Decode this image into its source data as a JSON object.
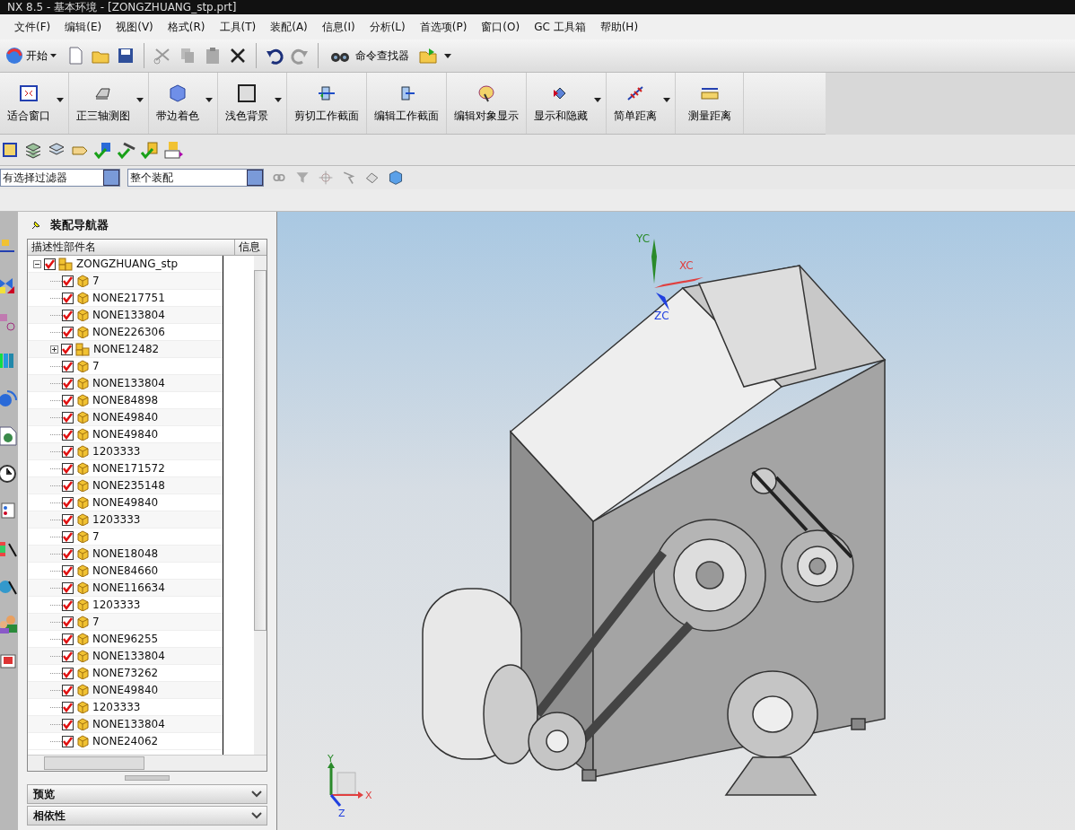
{
  "window": {
    "title": "NX 8.5 - 基本环境 - [ZONGZHUANG_stp.prt]"
  },
  "menu": [
    "文件(F)",
    "编辑(E)",
    "视图(V)",
    "格式(R)",
    "工具(T)",
    "装配(A)",
    "信息(I)",
    "分析(L)",
    "首选项(P)",
    "窗口(O)",
    "GC 工具箱",
    "帮助(H)"
  ],
  "standard_toolbar": {
    "start": "开始",
    "finder": "命令查找器"
  },
  "view_toolbar": [
    {
      "label": "适合窗口",
      "dropdown": true
    },
    {
      "label": "正三轴测图",
      "dropdown": true
    },
    {
      "label": "带边着色",
      "dropdown": true
    },
    {
      "label": "浅色背景",
      "dropdown": true
    },
    {
      "label": "剪切工作截面",
      "dropdown": false
    },
    {
      "label": "编辑工作截面",
      "dropdown": false
    },
    {
      "label": "编辑对象显示",
      "dropdown": false
    },
    {
      "label": "显示和隐藏",
      "dropdown": true
    },
    {
      "label": "简单距离",
      "dropdown": true
    },
    {
      "label": "测量距离",
      "dropdown": false
    }
  ],
  "selection_bar": {
    "filter": "有选择过滤器",
    "scope": "整个装配"
  },
  "navigator": {
    "title": "装配导航器",
    "columns": [
      "描述性部件名",
      "信息"
    ],
    "tree": [
      {
        "name": "ZONGZHUANG_stp",
        "kind": "assembly",
        "checked": true,
        "expanded": true,
        "children": [
          {
            "name": "7",
            "kind": "part",
            "checked": true
          },
          {
            "name": "NONE217751",
            "kind": "part",
            "checked": true
          },
          {
            "name": "NONE133804",
            "kind": "part",
            "checked": true
          },
          {
            "name": "NONE226306",
            "kind": "part",
            "checked": true
          },
          {
            "name": "NONE12482",
            "kind": "assembly",
            "checked": true,
            "expanded": false
          },
          {
            "name": "7",
            "kind": "part",
            "checked": true
          },
          {
            "name": "NONE133804",
            "kind": "part",
            "checked": true
          },
          {
            "name": "NONE84898",
            "kind": "part",
            "checked": true
          },
          {
            "name": "NONE49840",
            "kind": "part",
            "checked": true
          },
          {
            "name": "NONE49840",
            "kind": "part",
            "checked": true
          },
          {
            "name": "1203333",
            "kind": "part",
            "checked": true
          },
          {
            "name": "NONE171572",
            "kind": "part",
            "checked": true
          },
          {
            "name": "NONE235148",
            "kind": "part",
            "checked": true
          },
          {
            "name": "NONE49840",
            "kind": "part",
            "checked": true
          },
          {
            "name": "1203333",
            "kind": "part",
            "checked": true
          },
          {
            "name": "7",
            "kind": "part",
            "checked": true
          },
          {
            "name": "NONE18048",
            "kind": "part",
            "checked": true
          },
          {
            "name": "NONE84660",
            "kind": "part",
            "checked": true
          },
          {
            "name": "NONE116634",
            "kind": "part",
            "checked": true
          },
          {
            "name": "1203333",
            "kind": "part",
            "checked": true
          },
          {
            "name": "7",
            "kind": "part",
            "checked": true
          },
          {
            "name": "NONE96255",
            "kind": "part",
            "checked": true
          },
          {
            "name": "NONE133804",
            "kind": "part",
            "checked": true
          },
          {
            "name": "NONE73262",
            "kind": "part",
            "checked": true
          },
          {
            "name": "NONE49840",
            "kind": "part",
            "checked": true
          },
          {
            "name": "1203333",
            "kind": "part",
            "checked": true
          },
          {
            "name": "NONE133804",
            "kind": "part",
            "checked": true
          },
          {
            "name": "NONE24062",
            "kind": "part",
            "checked": true
          }
        ]
      }
    ]
  },
  "panels": [
    {
      "title": "预览",
      "expanded": false
    },
    {
      "title": "相依性",
      "expanded": false
    }
  ],
  "viewport": {
    "wcs_labels": [
      "XC",
      "YC",
      "ZC"
    ],
    "triad_labels": [
      "X",
      "Y",
      "Z"
    ]
  }
}
